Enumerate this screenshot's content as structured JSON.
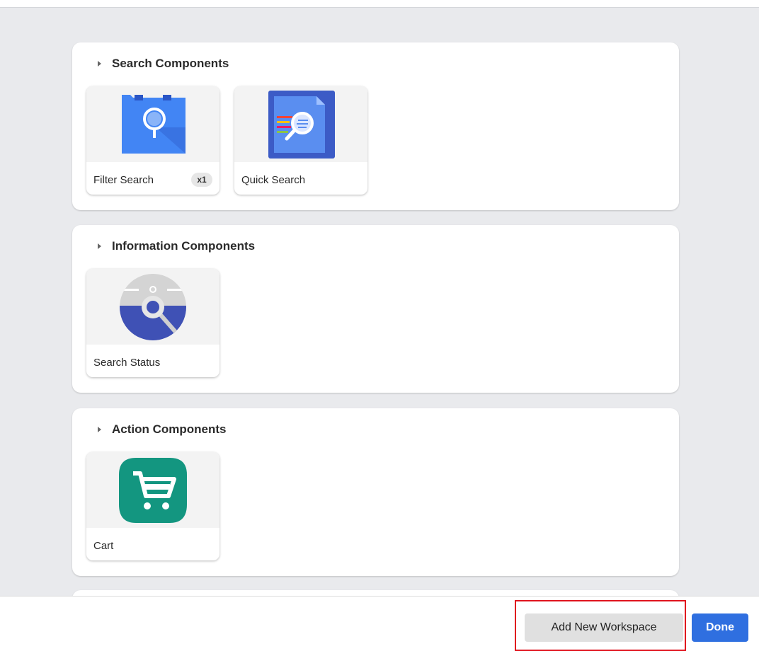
{
  "sections": [
    {
      "title": "Search Components",
      "items": [
        {
          "label": "Filter Search",
          "badge": "x1",
          "icon": "filter-search-icon"
        },
        {
          "label": "Quick Search",
          "icon": "quick-search-icon"
        }
      ]
    },
    {
      "title": "Information Components",
      "items": [
        {
          "label": "Search Status",
          "icon": "search-status-icon"
        }
      ]
    },
    {
      "title": "Action Components",
      "items": [
        {
          "label": "Cart",
          "icon": "cart-icon"
        }
      ]
    }
  ],
  "footer": {
    "add_workspace_label": "Add New Workspace",
    "done_label": "Done"
  },
  "colors": {
    "primary": "#2f6fe0",
    "highlight": "#e0141e",
    "filter_icon": "#4285f4",
    "quick_search_icon": "#3c5bc6",
    "status_icon": "#3f51b5",
    "cart_icon": "#139680"
  }
}
